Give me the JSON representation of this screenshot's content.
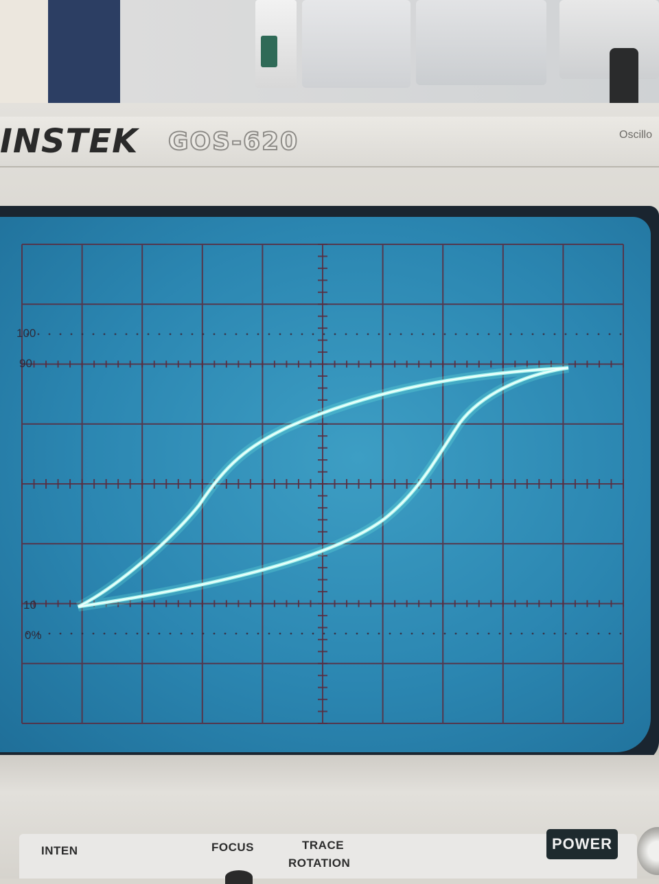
{
  "brand": {
    "name": "INSTEK",
    "model": "GOS-620",
    "tail": "Oscillo"
  },
  "screen": {
    "labels": {
      "l100": "100",
      "l90": "90",
      "l10": "10",
      "l0": "0%"
    },
    "trace_color": "#aef7ef",
    "grid_color": "#5b2a3c"
  },
  "controls": {
    "inten": "INTEN",
    "focus": "FOCUS",
    "trace": "TRACE",
    "rotation": "ROTATION",
    "power": "POWER"
  }
}
